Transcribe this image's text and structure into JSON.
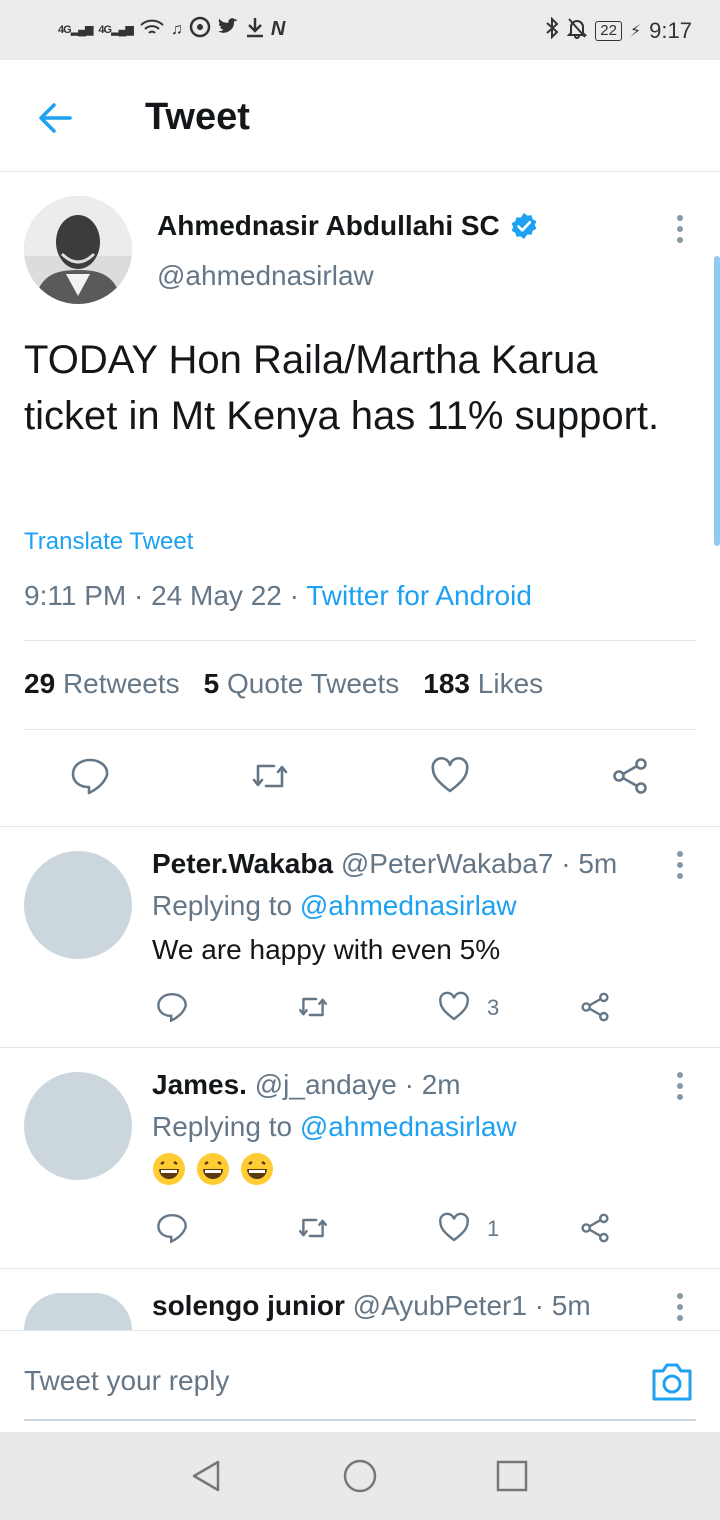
{
  "status_bar": {
    "signal1": "4G",
    "signal2": "4G",
    "battery": "22",
    "time": "9:17"
  },
  "header": {
    "title": "Tweet"
  },
  "tweet": {
    "author_name": "Ahmednasir Abdullahi SC",
    "handle": "@ahmednasirlaw",
    "text": "TODAY Hon Raila/Martha Karua ticket in Mt Kenya has 11% support.",
    "translate_label": "Translate Tweet",
    "time": "9:11 PM",
    "date": "24 May 22",
    "source": "Twitter for Android",
    "retweets_count": "29",
    "retweets_label": "Retweets",
    "quotes_count": "5",
    "quotes_label": "Quote Tweets",
    "likes_count": "183",
    "likes_label": "Likes"
  },
  "replies": [
    {
      "name": "Peter.Wakaba",
      "handle": "@PeterWakaba7",
      "age": "5m",
      "replying_prefix": "Replying to",
      "replying_to": "@ahmednasirlaw",
      "text": "We are happy with even 5%",
      "likes": "3"
    },
    {
      "name": "James.",
      "handle": "@j_andaye",
      "age": "2m",
      "replying_prefix": "Replying to",
      "replying_to": "@ahmednasirlaw",
      "emoji": [
        "grinning-face-emoji",
        "grinning-face-emoji",
        "grinning-face-emoji"
      ],
      "likes": "1"
    },
    {
      "name": "solengo junior",
      "handle": "@AyubPeter1",
      "age": "5m"
    }
  ],
  "reply_box": {
    "placeholder": "Tweet your reply"
  },
  "colors": {
    "accent": "#1da1f2",
    "secondary_text": "#657786",
    "avatar_placeholder": "#ccd6dd"
  }
}
